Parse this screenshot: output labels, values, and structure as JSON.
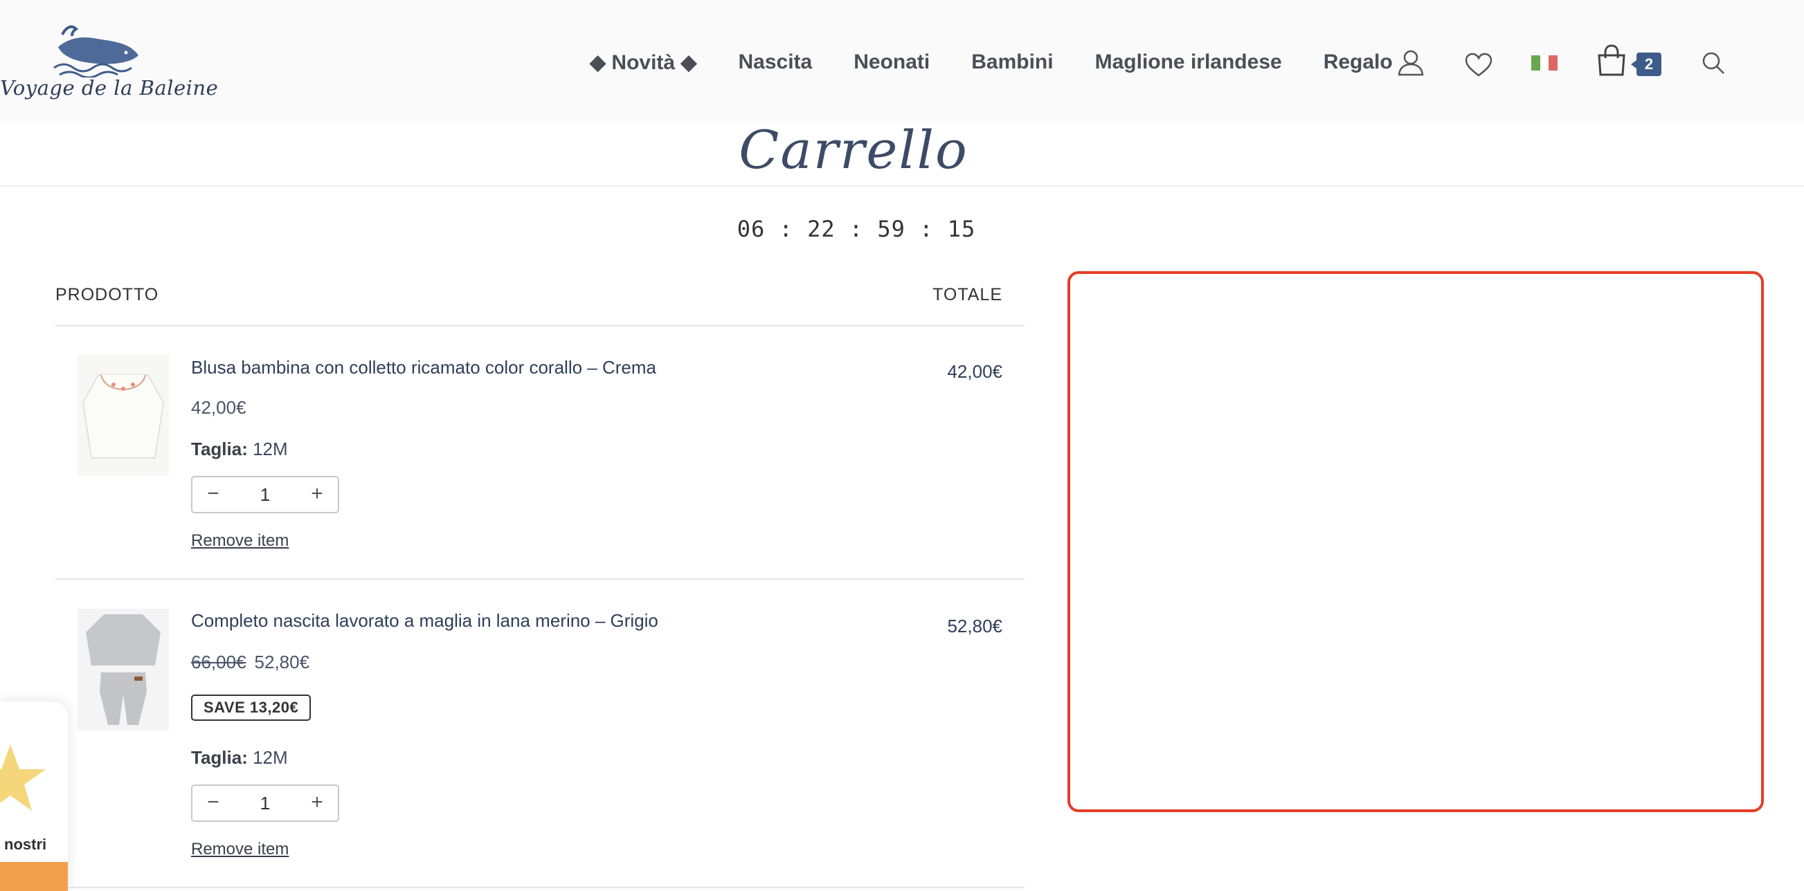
{
  "header": {
    "logo_text": "Voyage de la Baleine",
    "nav": [
      {
        "label": "◆ Novità ◆"
      },
      {
        "label": "Nascita"
      },
      {
        "label": "Neonati"
      },
      {
        "label": "Bambini"
      },
      {
        "label": "Maglione irlandese"
      },
      {
        "label": "Regalo"
      }
    ],
    "icons": [
      "user-icon",
      "heart-icon",
      "italian-flag-icon",
      "cart-icon",
      "search-icon"
    ],
    "cart_count": "2"
  },
  "page": {
    "title": "Carrello",
    "countdown": "06 : 22 : 59 : 15"
  },
  "table": {
    "col_product": "PRODOTTO",
    "col_total": "TOTALE"
  },
  "items": [
    {
      "name": "Blusa bambina con colletto ricamato color corallo – Crema",
      "price": "42,00€",
      "size_label": "Taglia:",
      "size": "12M",
      "quantity": "1",
      "remove": "Remove item",
      "line_total": "42,00€"
    },
    {
      "name": "Completo nascita lavorato a maglia in lana merino – Grigio",
      "old_price": "66,00€",
      "price": "52,80€",
      "save": "SAVE 13,20€",
      "size_label": "Taglia:",
      "size": "12M",
      "quantity": "1",
      "remove": "Remove item",
      "line_total": "52,80€"
    }
  ],
  "qty_controls": {
    "minus": "−",
    "plus": "+"
  },
  "review_widget": {
    "text": "nostri"
  },
  "colors": {
    "accent_border": "#e53d25",
    "badge": "#3e5c8a",
    "widget_bar": "#f0a04b"
  }
}
